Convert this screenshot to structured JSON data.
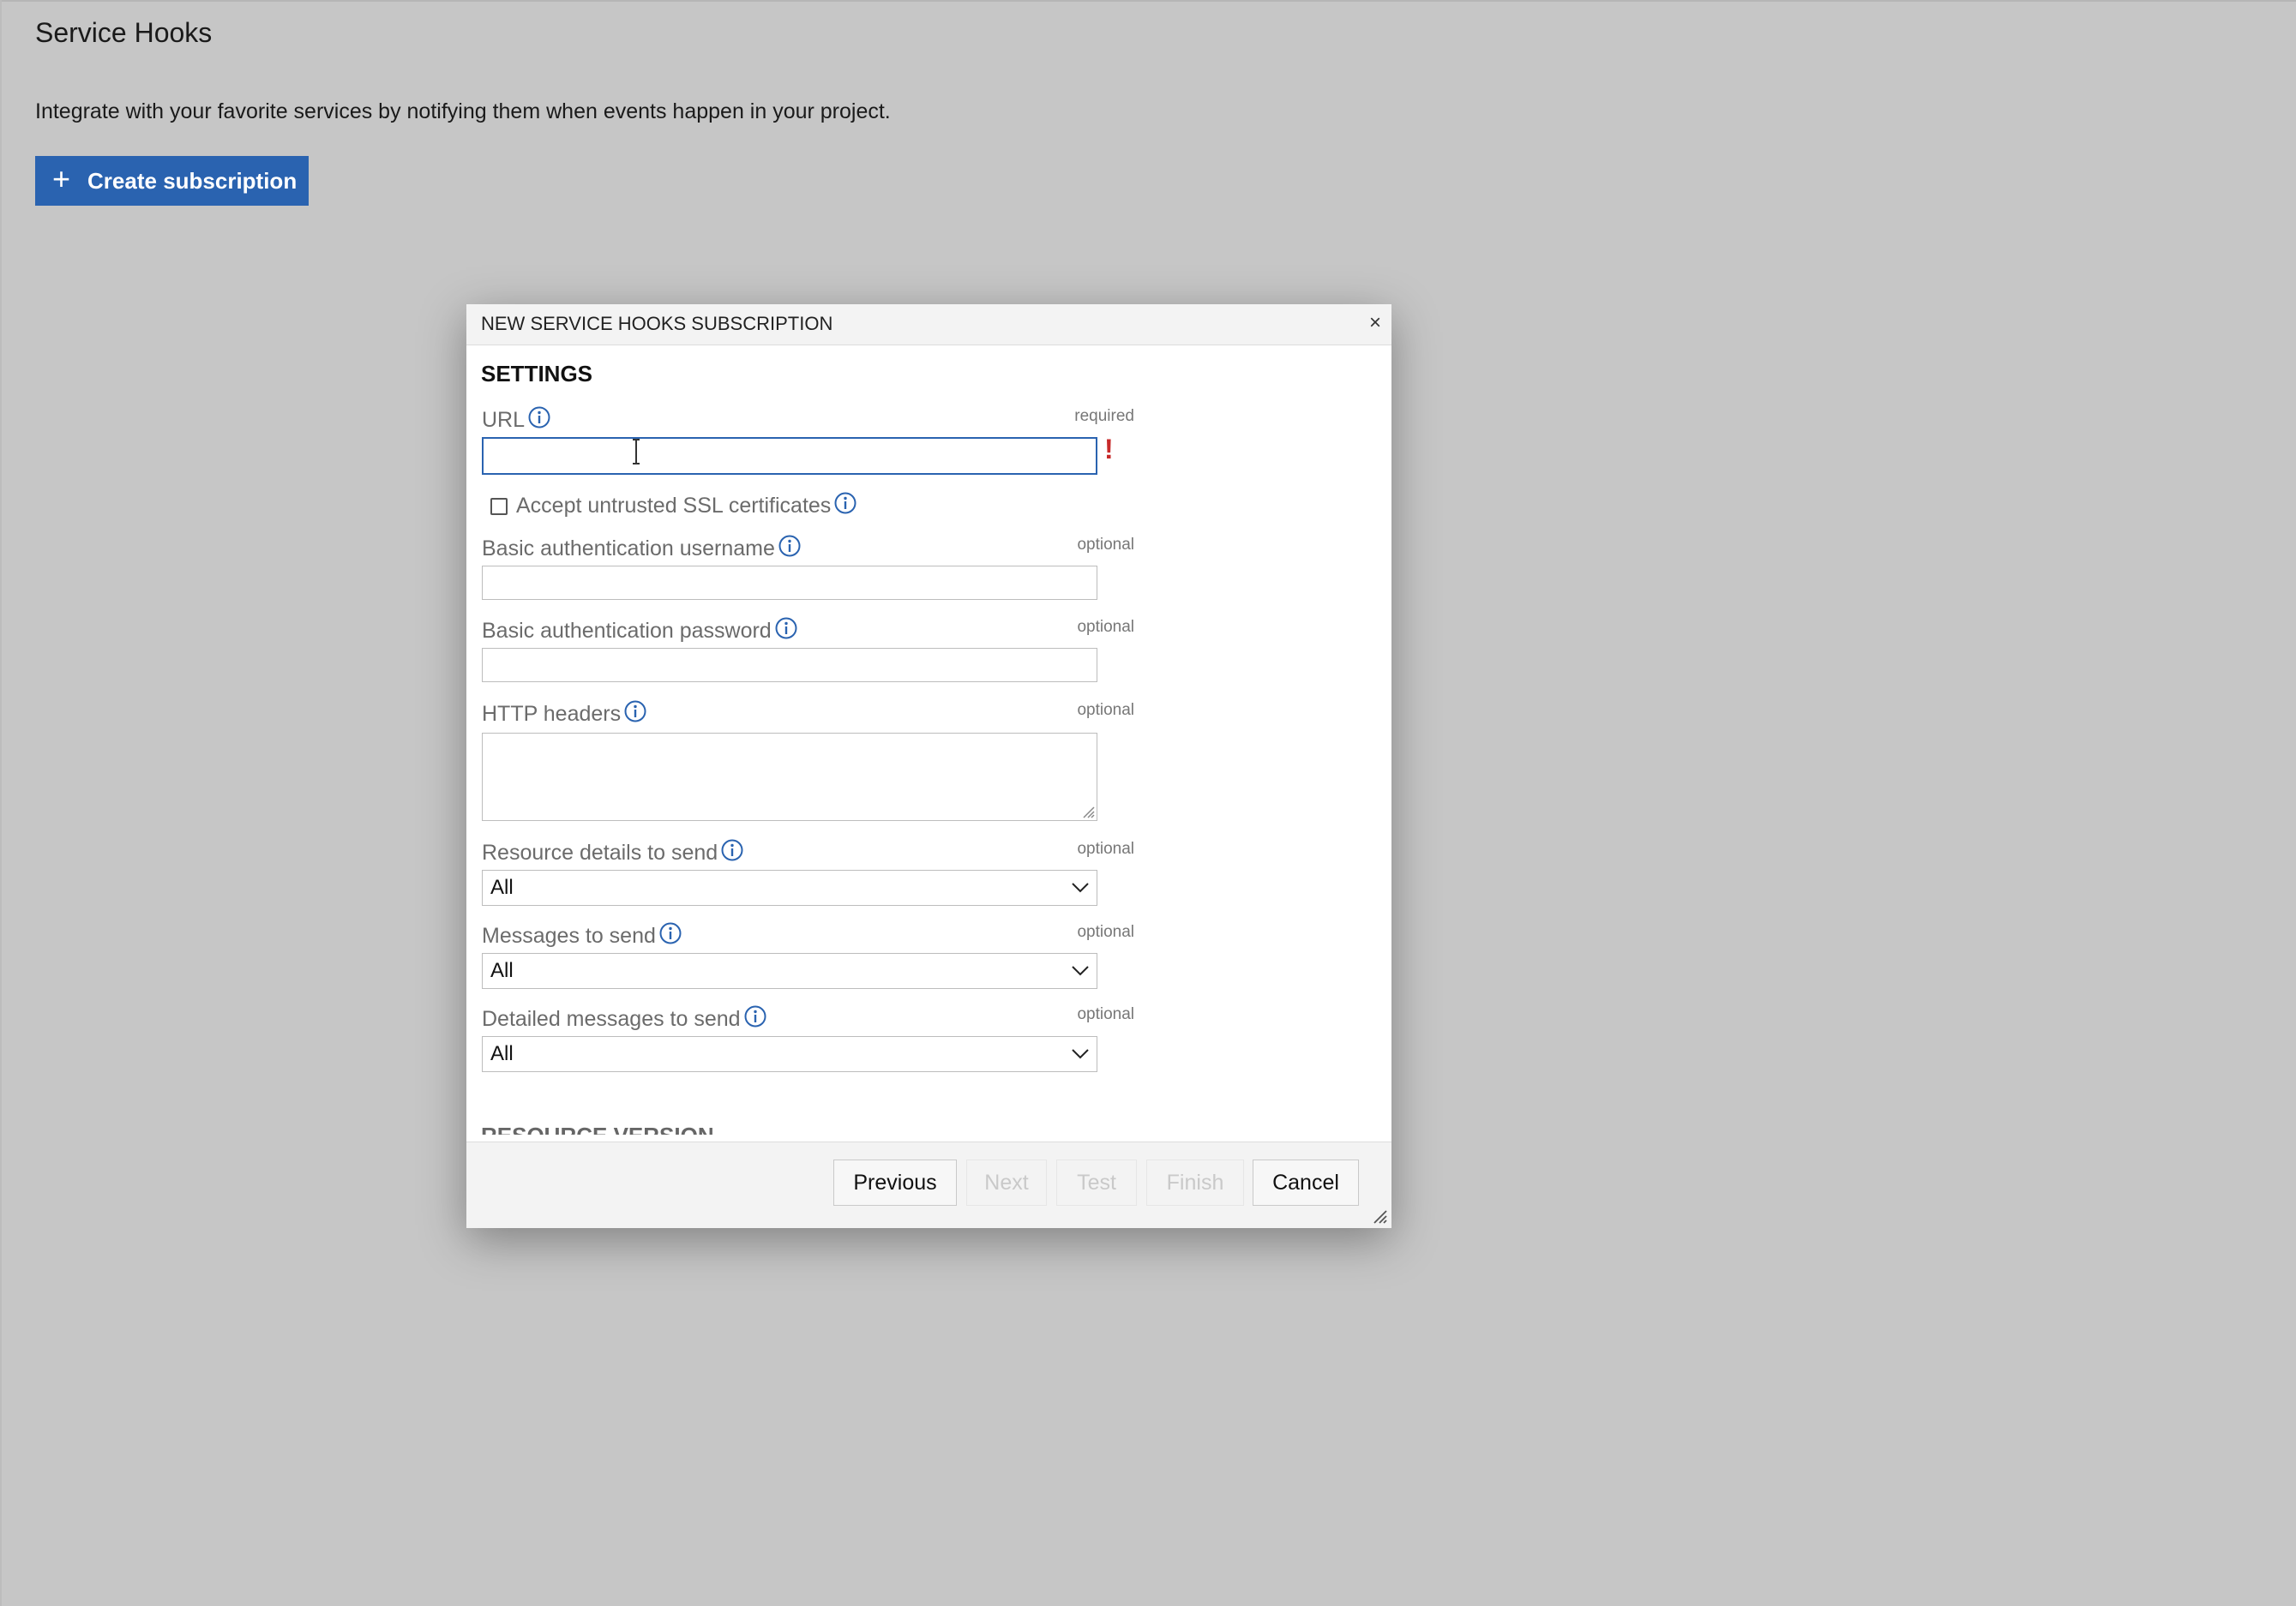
{
  "page": {
    "title": "Service Hooks",
    "description": "Integrate with your favorite services by notifying them when events happen in your project.",
    "create_button": {
      "icon": "plus-icon",
      "label": "Create subscription"
    }
  },
  "dialog": {
    "title": "NEW SERVICE HOOKS SUBSCRIPTION",
    "close_label": "×",
    "section_title": "SETTINGS",
    "fields": {
      "url": {
        "label": "URL",
        "tag": "required",
        "value": "",
        "error_mark": "!"
      },
      "accept_ssl": {
        "label": "Accept untrusted SSL certificates",
        "checked": false
      },
      "basic_auth_username": {
        "label": "Basic authentication username",
        "tag": "optional",
        "value": ""
      },
      "basic_auth_password": {
        "label": "Basic authentication password",
        "tag": "optional",
        "value": ""
      },
      "http_headers": {
        "label": "HTTP headers",
        "tag": "optional",
        "value": ""
      },
      "resource_details": {
        "label": "Resource details to send",
        "tag": "optional",
        "selected": "All"
      },
      "messages": {
        "label": "Messages to send",
        "tag": "optional",
        "selected": "All"
      },
      "detailed_messages": {
        "label": "Detailed messages to send",
        "tag": "optional",
        "selected": "All"
      }
    },
    "next_section_title": "RESOURCE VERSION",
    "footer": {
      "previous": "Previous",
      "next": "Next",
      "test": "Test",
      "finish": "Finish",
      "cancel": "Cancel"
    }
  },
  "colors": {
    "accent": "#2a63b0",
    "error": "#c72a2a",
    "overlay": "#c6c6c6"
  }
}
